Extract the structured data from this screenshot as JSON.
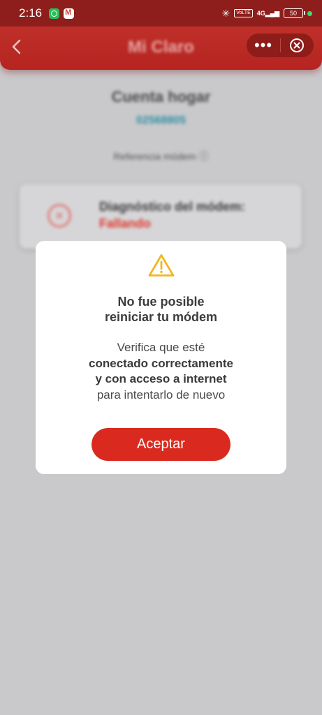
{
  "status_bar": {
    "time": "2:16",
    "network": "4G",
    "volte": "VoLTE",
    "battery": "50",
    "icons": [
      "whatsapp-icon",
      "gmail-icon",
      "bluetooth-icon",
      "volte-icon",
      "signal-icon",
      "battery-icon"
    ]
  },
  "app_bar": {
    "brand": "Mi Claro",
    "more_label": "•••",
    "colors": {
      "primary": "#b52420",
      "pill": "#8e1c19"
    }
  },
  "background": {
    "title": "Cuenta hogar",
    "account_number": "02568805",
    "modem_ref_label": "Referencia módem",
    "card_title": "Diagnóstico del módem:",
    "card_status": "Fallando"
  },
  "dialog": {
    "icon": "warning-icon",
    "title_line1": "No fue posible",
    "title_line2": "reiniciar tu módem",
    "body_line1": "Verifica que esté",
    "body_line2": "conectado correctamente",
    "body_line3": "y con acceso a internet",
    "body_line4": "para intentarlo de nuevo",
    "accept_label": "Aceptar",
    "colors": {
      "warning": "#f2b620",
      "button": "#da2a1f"
    }
  }
}
